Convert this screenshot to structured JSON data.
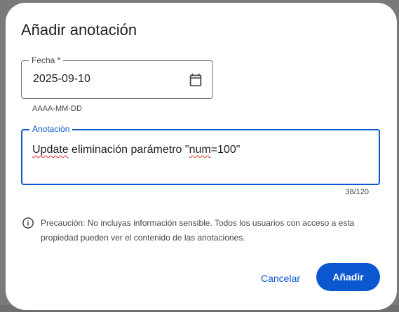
{
  "dialog": {
    "title": "Añadir anotación"
  },
  "date_field": {
    "label": "Fecha *",
    "value": "2025-09-10",
    "hint": "AAAA-MM-DD",
    "icon": "calendar-icon"
  },
  "annotation_field": {
    "label": "Anotación",
    "value_part1": "Update",
    "value_part2": " eliminación parámetro \"",
    "value_part3": "num",
    "value_part4": "=100\"",
    "counter": "38/120"
  },
  "notice": {
    "icon": "info-icon",
    "text": "Precaución: No incluyas información sensible. Todos los usuarios con acceso a esta propiedad pueden ver el contenido de las anotaciones."
  },
  "actions": {
    "cancel_label": "Cancelar",
    "add_label": "Añadir"
  },
  "colors": {
    "accent": "#0b57d0",
    "spell_error": "#d93025"
  }
}
